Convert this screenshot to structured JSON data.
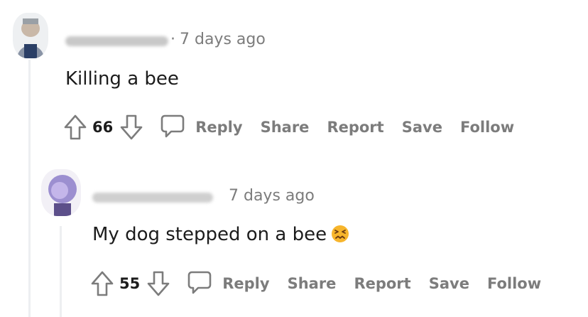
{
  "comment1": {
    "timestamp": "7 days ago",
    "separator": "·",
    "body": "Killing a bee",
    "score": "66",
    "actions": {
      "reply": "Reply",
      "share": "Share",
      "report": "Report",
      "save": "Save",
      "follow": "Follow"
    }
  },
  "comment2": {
    "timestamp": "7 days ago",
    "body": "My dog stepped on a bee",
    "emoji": "confounded-face-emoji",
    "score": "55",
    "actions": {
      "reply": "Reply",
      "share": "Share",
      "report": "Report",
      "save": "Save",
      "follow": "Follow"
    }
  },
  "colors": {
    "text": "#1c1c1c",
    "meta": "#7c7c7c",
    "thread_line": "#edeff1",
    "emoji": "#f7b52c"
  },
  "icons": [
    "upvote-icon",
    "downvote-icon",
    "comment-icon"
  ]
}
